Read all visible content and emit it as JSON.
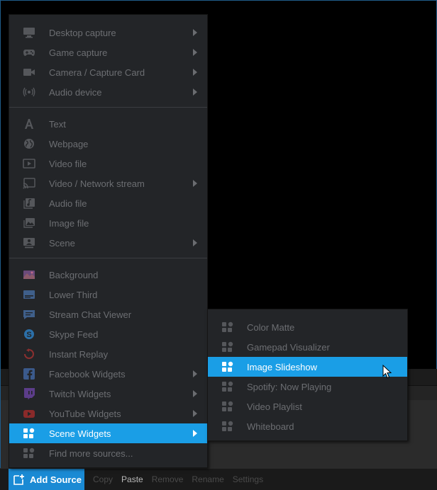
{
  "main_menu": {
    "capture": [
      {
        "label": "Desktop capture",
        "icon": "monitor-icon",
        "submenu": true
      },
      {
        "label": "Game capture",
        "icon": "gamepad-icon",
        "submenu": true
      },
      {
        "label": "Camera / Capture Card",
        "icon": "camera-icon",
        "submenu": true
      },
      {
        "label": "Audio device",
        "icon": "audio-device-icon",
        "submenu": true
      }
    ],
    "media": [
      {
        "label": "Text",
        "icon": "text-icon",
        "submenu": false
      },
      {
        "label": "Webpage",
        "icon": "globe-icon",
        "submenu": false
      },
      {
        "label": "Video file",
        "icon": "video-file-icon",
        "submenu": false
      },
      {
        "label": "Video / Network stream",
        "icon": "cast-icon",
        "submenu": true
      },
      {
        "label": "Audio file",
        "icon": "audio-file-icon",
        "submenu": false
      },
      {
        "label": "Image file",
        "icon": "image-icon",
        "submenu": false
      },
      {
        "label": "Scene",
        "icon": "scene-icon",
        "submenu": true
      }
    ],
    "widgets": [
      {
        "label": "Background",
        "icon": "background-icon",
        "submenu": false
      },
      {
        "label": "Lower Third",
        "icon": "lower-third-icon",
        "submenu": false
      },
      {
        "label": "Stream Chat Viewer",
        "icon": "chat-icon",
        "submenu": false
      },
      {
        "label": "Skype Feed",
        "icon": "skype-icon",
        "submenu": false
      },
      {
        "label": "Instant Replay",
        "icon": "replay-icon",
        "submenu": false
      },
      {
        "label": "Facebook Widgets",
        "icon": "facebook-icon",
        "submenu": true
      },
      {
        "label": "Twitch Widgets",
        "icon": "twitch-icon",
        "submenu": true
      },
      {
        "label": "YouTube Widgets",
        "icon": "youtube-icon",
        "submenu": true
      },
      {
        "label": "Scene Widgets",
        "icon": "widgets-icon",
        "submenu": true,
        "active": true
      },
      {
        "label": "Find more sources...",
        "icon": "widgets-icon",
        "submenu": false
      }
    ]
  },
  "sub_menu": {
    "items": [
      {
        "label": "Color Matte",
        "icon": "widgets-icon"
      },
      {
        "label": "Gamepad Visualizer",
        "icon": "widgets-icon"
      },
      {
        "label": "Image Slideshow",
        "icon": "widgets-icon",
        "active": true
      },
      {
        "label": "Spotify: Now Playing",
        "icon": "widgets-icon"
      },
      {
        "label": "Video Playlist",
        "icon": "widgets-icon"
      },
      {
        "label": "Whiteboard",
        "icon": "widgets-icon"
      }
    ]
  },
  "bottom_bar": {
    "add_source_label": "Add Source",
    "actions": [
      "Copy",
      "Paste",
      "Remove",
      "Rename",
      "Settings"
    ]
  },
  "colors": {
    "accent": "#1a9ee6",
    "menu_bg": "#232528",
    "text_muted": "#6c6e72"
  }
}
